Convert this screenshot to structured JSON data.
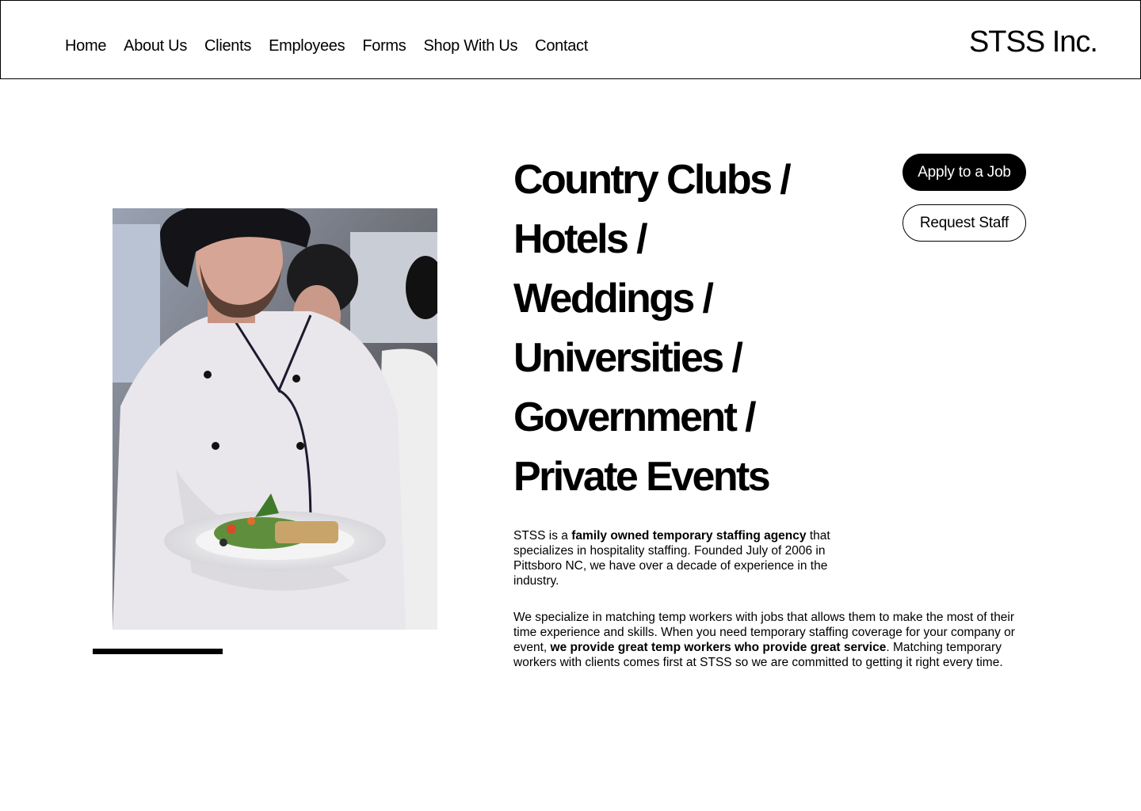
{
  "header": {
    "nav": [
      "Home",
      "About Us",
      "Clients",
      "Employees",
      "Forms",
      "Shop With Us",
      "Contact"
    ],
    "brand": "STSS Inc."
  },
  "hero": {
    "headline_lines": [
      "Country Clubs /",
      "Hotels /",
      "Weddings /",
      "Universities /",
      "Government /",
      "Private Events"
    ],
    "photo_alt": "Chef in white coat holding a plate of food"
  },
  "actions": {
    "apply_label": "Apply to a Job",
    "request_label": "Request Staff"
  },
  "about": {
    "p1_pre": "STSS is a ",
    "p1_bold": "family owned temporary staffing agency",
    "p1_post": " that specializes in hospitality staffing. Founded July of 2006 in Pittsboro NC, we have over a decade of experience in the industry.",
    "p2_pre": "We specialize in matching temp workers with jobs that allows them to make the most of their time experience and skills. When you need temporary staffing coverage for your company or event, ",
    "p2_bold": "we provide great temp workers who provide great service",
    "p2_post": ". Matching temporary workers with clients comes first at STSS so we are committed to getting it right every time."
  },
  "colors": {
    "text": "#000000",
    "background": "#ffffff",
    "button_primary": "#000000"
  }
}
